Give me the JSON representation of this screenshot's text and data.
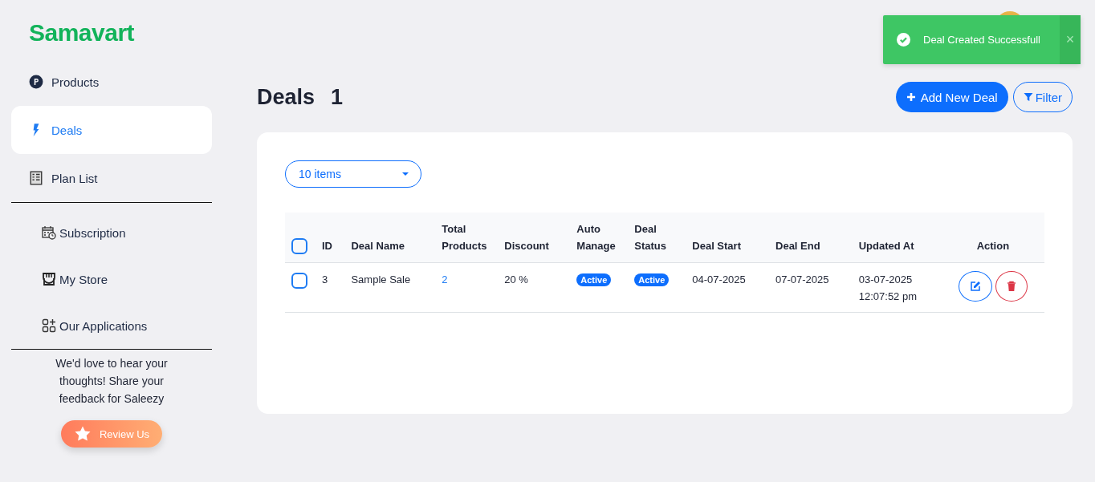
{
  "brand": {
    "logo": "Samavart"
  },
  "sidebar": {
    "items": [
      {
        "label": "Products",
        "selected": false
      },
      {
        "label": "Deals",
        "selected": true
      },
      {
        "label": "Plan List",
        "selected": false
      }
    ],
    "more_items": [
      {
        "label": "Subscription"
      },
      {
        "label": "My Store"
      },
      {
        "label": "Our Applications"
      }
    ],
    "feedback": {
      "text": "We'd love to hear your thoughts! Share your feedback for Saleezy",
      "button": "Review Us"
    }
  },
  "header": {
    "title": "Deals",
    "count": "1",
    "buttons": [
      {
        "label": "Add New Deal",
        "kind": "primary"
      },
      {
        "label": "Filter",
        "kind": "outline"
      }
    ]
  },
  "toast": {
    "message": "Deal Created Successfull",
    "close": "×"
  },
  "page_size": {
    "value": "10 items"
  },
  "table": {
    "columns": [
      "ID",
      "Deal Name",
      "Total Products",
      "Discount",
      "Auto Manage",
      "Deal Status",
      "Deal Start",
      "Deal End",
      "Updated At",
      "Action"
    ],
    "header_checked": false,
    "rows": [
      {
        "checked": false,
        "id": "3",
        "name": "Sample Sale",
        "total_products": "2",
        "discount": "20 %",
        "auto_manage": "Active",
        "status": "Active",
        "start": "04-07-2025",
        "end": "07-07-2025",
        "updated_date": "03-07-2025",
        "updated_time": "12:07:52 pm"
      }
    ]
  }
}
